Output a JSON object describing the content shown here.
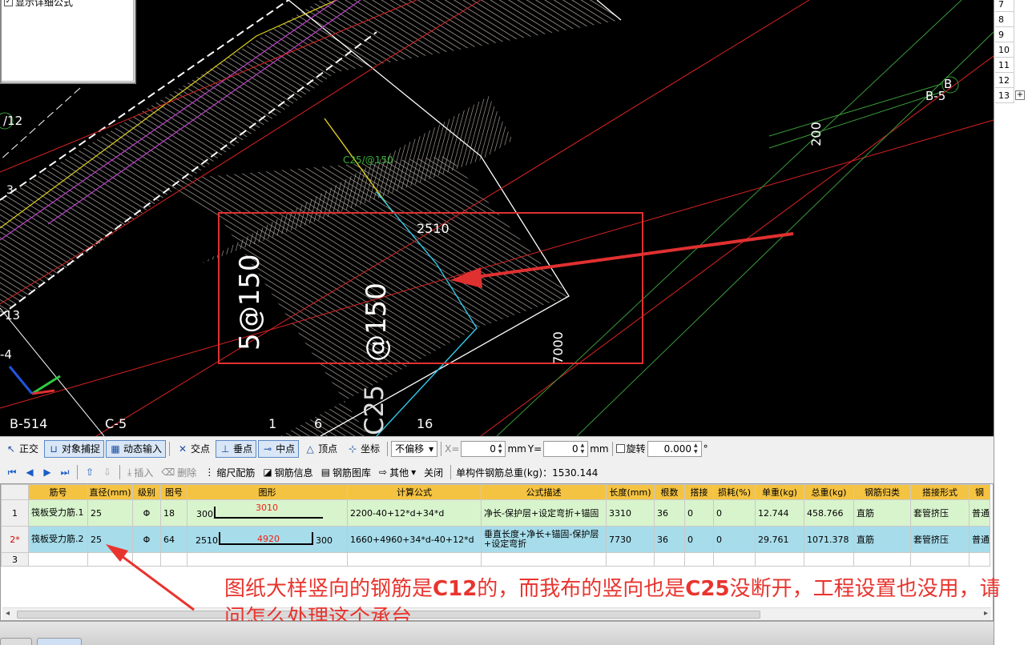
{
  "canvas": {
    "options_panel": {
      "checkbox_label": "显示详细公式",
      "checked": true
    },
    "axis_labels": {
      "b5_top": "B-5",
      "b_circle": "B",
      "a12": "/12",
      "n3": "3",
      "n13": "13",
      "c4": "-4",
      "b514": "B-514",
      "c5": "C-5",
      "n16": "16",
      "n1": "1",
      "c6": "6"
    },
    "dimensions": {
      "d2510": "2510",
      "d7000": "7000",
      "d200": "200"
    },
    "rebar_texts": {
      "t1": "5@150",
      "t2": "@150",
      "t3": "C25",
      "green_label": "C25/@150"
    }
  },
  "right_column": {
    "rows": [
      "7",
      "8",
      "9",
      "10",
      "11",
      "12",
      "13"
    ],
    "expand": "+"
  },
  "snap_toolbar": {
    "ortho": "正交",
    "object_snap": "对象捕捉",
    "dynamic_input": "动态输入",
    "intersection": "交点",
    "perpendicular": "垂点",
    "midpoint": "中点",
    "vertex": "顶点",
    "coordinate": "坐标",
    "offset_select": "不偏移",
    "x_label": "X=",
    "x_value": "0",
    "x_unit": "mm",
    "y_label": "Y=",
    "y_value": "0",
    "y_unit": "mm",
    "rotate_label": "旋转",
    "rotate_value": "0.000",
    "degree": "°"
  },
  "rebar_toolbar": {
    "insert": "插入",
    "delete": "删除",
    "scale_rebar": "缩尺配筋",
    "rebar_info": "钢筋信息",
    "rebar_library": "钢筋图库",
    "other": "其他",
    "close": "关闭",
    "total_weight_label": "单构件钢筋总重(kg)：1530.144"
  },
  "grid": {
    "columns": [
      "筋号",
      "直径(mm)",
      "级别",
      "图号",
      "图形",
      "计算公式",
      "公式描述",
      "长度(mm)",
      "根数",
      "搭接",
      "损耗(%)",
      "单重(kg)",
      "总重(kg)",
      "钢筋归类",
      "搭接形式",
      "钢"
    ],
    "rows": [
      {
        "num": "1",
        "name": "筏板受力筋.1",
        "diameter": "25",
        "grade": "Φ",
        "fig_no": "18",
        "shape_left": "300",
        "shape_mid": "3010",
        "shape_right": "",
        "formula": "2200-40+12*d+34*d",
        "description": "净长-保护层+设定弯折+锚固",
        "length": "3310",
        "count": "36",
        "lap": "0",
        "loss": "0",
        "unit_weight": "12.744",
        "total_weight": "458.766",
        "category": "直筋",
        "lap_type": "套管挤压",
        "steel": "普通"
      },
      {
        "num": "2*",
        "name": "筏板受力筋.2",
        "diameter": "25",
        "grade": "Φ",
        "fig_no": "64",
        "shape_left": "2510",
        "shape_mid": "4920",
        "shape_right": "300",
        "formula": "1660+4960+34*d-40+12*d",
        "description": "垂直长度+净长+锚固-保护层+设定弯折",
        "length": "7730",
        "count": "36",
        "lap": "0",
        "loss": "0",
        "unit_weight": "29.761",
        "total_weight": "1071.378",
        "category": "直筋",
        "lap_type": "套管挤压",
        "steel": "普通"
      },
      {
        "num": "3"
      }
    ]
  },
  "annotation": {
    "part1": "图纸大样竖向的钢筋是",
    "bold1": "C12",
    "part2": "的，而我布的竖向也是",
    "bold2": "C25",
    "part3": "没断开，工程设置也没用，请问怎么处理这个承台"
  },
  "colors": {
    "canvas_bg": "#000000",
    "header_bg": "#f5c342",
    "row1_bg": "#d8f4cd",
    "row2_bg": "#a7dcea",
    "annotation": "#e8342e"
  }
}
